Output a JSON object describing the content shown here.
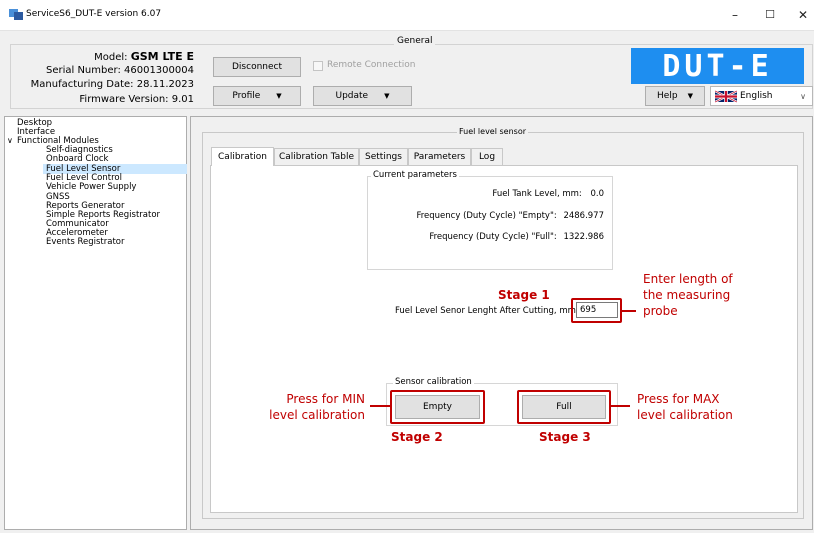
{
  "window": {
    "title": "ServiceS6_DUT-E version 6.07",
    "controls": {
      "minimize": "–",
      "maximize": "☐",
      "close": "✕"
    }
  },
  "general": {
    "title": "General",
    "model_label": "Model:",
    "model_value": "GSM LTE E",
    "serial_label": "Serial Number:",
    "serial_value": "46001300004",
    "mfg_label": "Manufacturing Date:",
    "mfg_value": "28.11.2023",
    "fw_label": "Firmware Version:",
    "fw_value": "9.01",
    "disconnect_label": "Disconnect",
    "remote_label": "Remote Connection",
    "profile_label": "Profile",
    "update_label": "Update",
    "help_label": "Help",
    "language": "English",
    "logo": "DUT-E"
  },
  "tree": {
    "items": [
      {
        "label": "Desktop",
        "level": 0
      },
      {
        "label": "Interface",
        "level": 0
      },
      {
        "label": "Functional Modules",
        "level": 0
      },
      {
        "label": "Self-diagnostics",
        "level": 1
      },
      {
        "label": "Onboard Clock",
        "level": 1
      },
      {
        "label": "Fuel Level Sensor",
        "level": 1,
        "selected": true
      },
      {
        "label": "Fuel Level Control",
        "level": 1
      },
      {
        "label": "Vehicle Power Supply",
        "level": 1
      },
      {
        "label": "GNSS",
        "level": 1
      },
      {
        "label": "Reports Generator",
        "level": 1
      },
      {
        "label": "Simple Reports Registrator",
        "level": 1
      },
      {
        "label": "Communicator",
        "level": 1
      },
      {
        "label": "Accelerometer",
        "level": 1
      },
      {
        "label": "Events Registrator",
        "level": 1
      }
    ],
    "expander": "∨"
  },
  "fuel_sensor": {
    "group_title": "Fuel level sensor",
    "tabs": [
      "Calibration",
      "Calibration Table",
      "Settings",
      "Parameters",
      "Log"
    ],
    "active_tab": "Calibration",
    "current_params_title": "Current parameters",
    "params": [
      {
        "label": "Fuel Tank Level, mm:",
        "value": "0.0"
      },
      {
        "label": "Frequency (Duty Cycle) \"Empty\":",
        "value": "2486.977"
      },
      {
        "label": "Frequency (Duty Cycle) \"Full\":",
        "value": "1322.986"
      }
    ],
    "length_label": "Fuel Level Senor Lenght After Cutting, mm:",
    "length_value": "695",
    "sensor_calibration_title": "Sensor calibration",
    "empty_label": "Empty",
    "full_label": "Full"
  },
  "annotations": {
    "stage1": "Stage 1",
    "stage2": "Stage 2",
    "stage3": "Stage 3",
    "enter_length_line1": "Enter length of",
    "enter_length_line2": "the measuring",
    "enter_length_line3": "probe",
    "press_min_line1": "Press for MIN",
    "press_min_line2": "level calibration",
    "press_max_line1": "Press for MAX",
    "press_max_line2": "level calibration",
    "color": "#c00000"
  },
  "colors": {
    "logo_bg": "#1e8ef0",
    "selection": "#cce8ff",
    "window_bg": "#f0f0f0"
  }
}
